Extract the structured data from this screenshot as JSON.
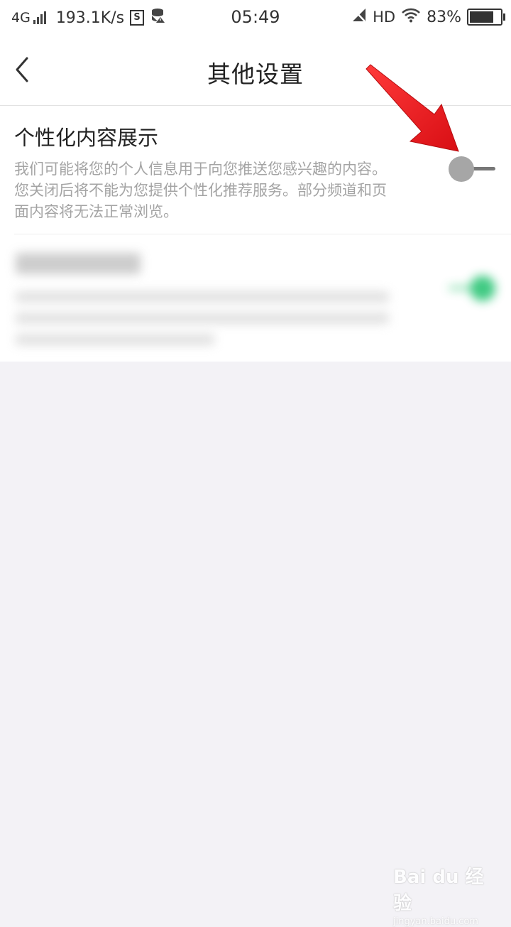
{
  "status_bar": {
    "network": "4G",
    "speed": "193.1K/s",
    "s_badge": "S",
    "time": "05:49",
    "hd": "HD",
    "battery": "83%",
    "battery_level": 0.83
  },
  "nav": {
    "title": "其他设置"
  },
  "settings": [
    {
      "title": "个性化内容展示",
      "description": "我们可能将您的个人信息用于向您推送您感兴趣的内容。您关闭后将不能为您提供个性化推荐服务。部分频道和页面内容将无法正常浏览。",
      "enabled": false
    }
  ],
  "colors": {
    "toggle_on": "#1fc16d",
    "toggle_off": "#a6a6a6",
    "arrow": "#e8161b",
    "background": "#f3f2f6"
  },
  "watermark": {
    "logo": "Bai du 经验",
    "url": "jingyan.baidu.com"
  }
}
